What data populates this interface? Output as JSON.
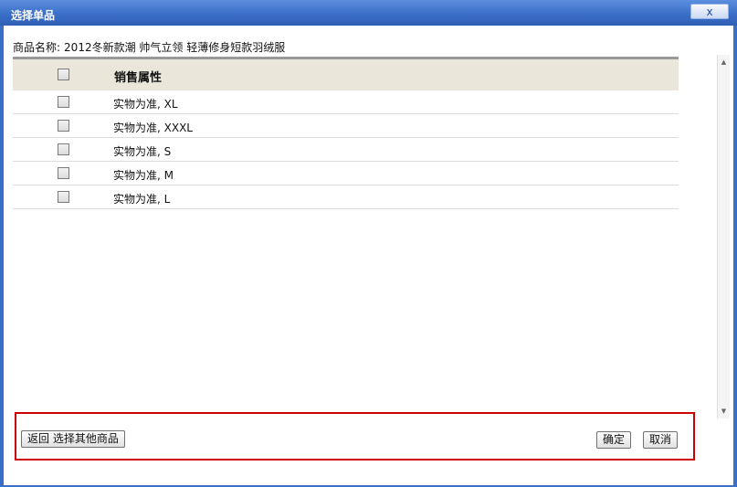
{
  "window": {
    "title": "选择单品",
    "close_label": "x"
  },
  "product": {
    "label": "商品名称:",
    "name": "2012冬新款潮 帅气立领 轻薄修身短款羽绒服"
  },
  "table": {
    "header": "销售属性",
    "rows": [
      {
        "value": "实物为准, XL"
      },
      {
        "value": "实物为准, XXXL"
      },
      {
        "value": "实物为准, S"
      },
      {
        "value": "实物为准, M"
      },
      {
        "value": "实物为准, L"
      }
    ]
  },
  "footer": {
    "back_label": "返回 选择其他商品",
    "ok_label": "确定",
    "cancel_label": "取消"
  },
  "icons": {
    "scroll_up": "scroll-up-icon",
    "scroll_down": "scroll-down-icon"
  },
  "colors": {
    "titlebar": "#3a6fc8",
    "highlight_border": "#cc0000",
    "header_bg": "#eae7da"
  }
}
